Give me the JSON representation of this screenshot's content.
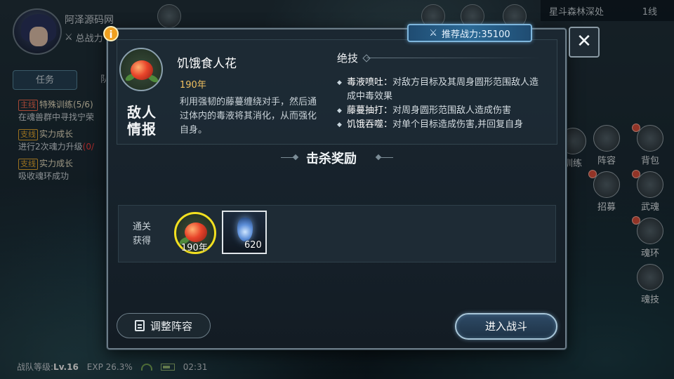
{
  "player": {
    "name": "阿泽源码网",
    "power_label": "总战力"
  },
  "location": {
    "name": "星斗森林深处",
    "line": "1线"
  },
  "quest_panel": {
    "tabs": [
      "任务",
      "队伍"
    ],
    "quests": [
      {
        "tag": "主线",
        "title": "特殊训练",
        "progress": "(5/6)",
        "desc": "在魂兽群中寻找宁荣"
      },
      {
        "tag": "支线",
        "title": "实力成长",
        "progress": "",
        "desc": "进行2次魂力升级",
        "desc_progress": "(0/"
      },
      {
        "tag": "支线",
        "title": "实力成长",
        "progress": "",
        "desc": "吸收魂环成功"
      }
    ]
  },
  "side_menu": [
    {
      "label": "训练"
    },
    {
      "label": "阵容"
    },
    {
      "label": "背包"
    },
    {
      "label": "招募"
    },
    {
      "label": "武魂"
    },
    {
      "label": "魂环"
    },
    {
      "label": "魂技"
    }
  ],
  "status": {
    "level_label": "战队等级:",
    "level": "Lv.16",
    "exp": "EXP 26.3%",
    "time": "02:31"
  },
  "modal": {
    "recommend_power": "推荐战力:35100",
    "close_icon": "close-icon",
    "enemy_info_label": "敌人情报",
    "enemy": {
      "name": "饥饿食人花",
      "age": "190年",
      "description": "利用强韧的藤蔓缠绕对手，然后通过体内的毒液将其消化，从而强化自身。"
    },
    "skills_title": "绝技",
    "skills": [
      {
        "name": "毒液喷吐：",
        "desc": "对敌方目标及其周身圆形范围敌人造成中毒效果"
      },
      {
        "name": "藤蔓抽打：",
        "desc": "对周身圆形范围敌人造成伤害"
      },
      {
        "name": "饥饿吞噬：",
        "desc": "对单个目标造成伤害,并回复自身"
      }
    ],
    "rewards_title": "击杀奖励",
    "rewards_label": "通关获得",
    "rewards": [
      {
        "icon": "flower-ring-icon",
        "qty": "190年"
      },
      {
        "icon": "potion-vial-icon",
        "qty": "620"
      }
    ],
    "adjust_label": "调整阵容",
    "battle_label": "进入战斗"
  }
}
